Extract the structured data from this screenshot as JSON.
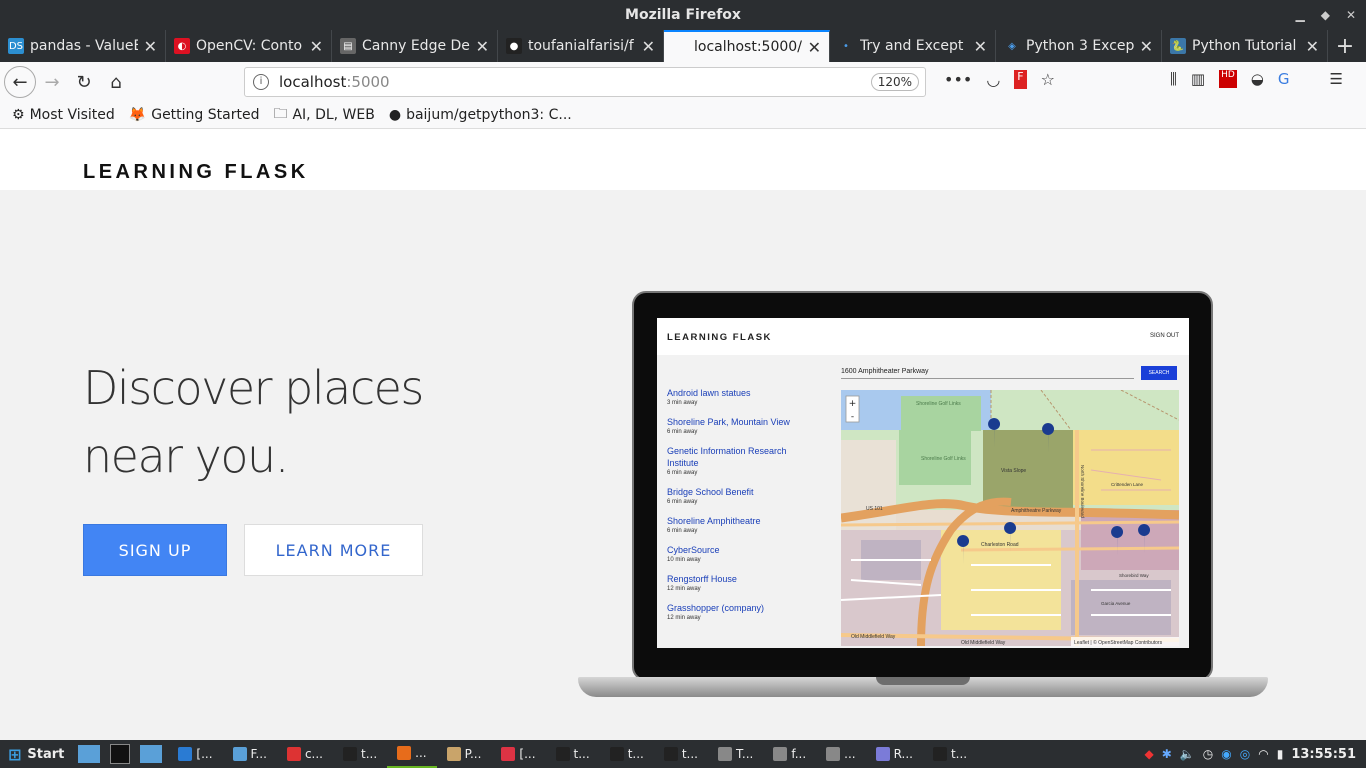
{
  "window": {
    "title": "Mozilla Firefox"
  },
  "tabs": [
    {
      "label": "pandas - ValueE",
      "icon": "pandas-favicon",
      "color": "#2c8fd1",
      "glyph": "DS",
      "active": false
    },
    {
      "label": "OpenCV: Conto",
      "icon": "opencv-favicon",
      "color": "#d12",
      "glyph": "◐",
      "active": false
    },
    {
      "label": "Canny Edge De",
      "icon": "document-favicon",
      "color": "#666",
      "glyph": "▤",
      "active": false
    },
    {
      "label": "toufanialfarisi/f",
      "icon": "github-favicon",
      "color": "#222",
      "glyph": "●",
      "active": false
    },
    {
      "label": "localhost:5000/",
      "icon": "none",
      "color": "transparent",
      "glyph": "",
      "active": true
    },
    {
      "label": "Try and Except",
      "icon": "dot-favicon",
      "color": "transparent",
      "glyph": "•",
      "active": false
    },
    {
      "label": "Python 3 Excep",
      "icon": "diamond-favicon",
      "color": "transparent",
      "glyph": "◈",
      "active": false
    },
    {
      "label": "Python Tutorial",
      "icon": "python-favicon",
      "color": "#3b77a8",
      "glyph": "🐍",
      "active": false
    }
  ],
  "nav": {
    "url_host": "localhost",
    "url_port": ":5000",
    "zoom": "120%"
  },
  "bookmarks": [
    {
      "label": "Most Visited",
      "icon": "gear-icon",
      "glyph": "⚙"
    },
    {
      "label": "Getting Started",
      "icon": "firefox-icon",
      "glyph": "🦊"
    },
    {
      "label": "AI, DL, WEB",
      "icon": "folder-icon",
      "glyph": "🗀"
    },
    {
      "label": "baijum/getpython3: C...",
      "icon": "github-icon",
      "glyph": "●"
    }
  ],
  "site": {
    "brand": "LEARNING FLASK",
    "hero_line1": "Discover places",
    "hero_line2": "near you.",
    "signup_label": "SIGN UP",
    "learn_label": "LEARN MORE",
    "accent": "#4285f4"
  },
  "mock": {
    "brand": "LEARNING FLASK",
    "signout": "SIGN OUT",
    "search_value": "1600 Amphitheater Parkway",
    "search_button": "SEARCH",
    "places": [
      {
        "name": "Android lawn statues",
        "dist": "3 min away"
      },
      {
        "name": "Shoreline Park, Mountain View",
        "dist": "6 min away"
      },
      {
        "name": "Genetic Information Research Institute",
        "dist": "6 min away"
      },
      {
        "name": "Bridge School Benefit",
        "dist": "6 min away"
      },
      {
        "name": "Shoreline Amphitheatre",
        "dist": "6 min away"
      },
      {
        "name": "CyberSource",
        "dist": "10 min away"
      },
      {
        "name": "Rengstorff House",
        "dist": "12 min away"
      },
      {
        "name": "Grasshopper (company)",
        "dist": "12 min away"
      }
    ],
    "map": {
      "zoom_in": "+",
      "zoom_out": "-",
      "attribution": "Leaflet | © OpenStreetMap Contributors",
      "labels": [
        "Shoreline Golf Links",
        "Shoreline Golf Links",
        "Vista Slope",
        "Amphitheatre Parkway",
        "Charleston Road",
        "US 101",
        "Old Middlefield Way",
        "Old Middlefield Way",
        "Crittenden Lane",
        "North Shoreline Boulevard",
        "Shorebird Way",
        "Garcia Avenue"
      ]
    }
  },
  "taskbar": {
    "start_label": "Start",
    "items": [
      {
        "label": "[...",
        "icon": "vscode-icon",
        "color": "#2a7bd3"
      },
      {
        "label": "F...",
        "icon": "files-icon",
        "color": "#5aa0d8"
      },
      {
        "label": "c...",
        "icon": "app-icon",
        "color": "#d33"
      },
      {
        "label": "t...",
        "icon": "terminal-icon",
        "color": "#222"
      },
      {
        "label": "...",
        "icon": "firefox-icon",
        "color": "#e76c1b"
      },
      {
        "label": "P...",
        "icon": "package-icon",
        "color": "#c9a46a"
      },
      {
        "label": "[...",
        "icon": "app2-icon",
        "color": "#d34"
      },
      {
        "label": "t...",
        "icon": "terminal-icon",
        "color": "#222"
      },
      {
        "label": "t...",
        "icon": "terminal-icon",
        "color": "#222"
      },
      {
        "label": "t...",
        "icon": "terminal-icon",
        "color": "#222"
      },
      {
        "label": "T...",
        "icon": "window-icon",
        "color": "#888"
      },
      {
        "label": "f...",
        "icon": "window-icon",
        "color": "#888"
      },
      {
        "label": "...",
        "icon": "window-icon",
        "color": "#888"
      },
      {
        "label": "R...",
        "icon": "reader-icon",
        "color": "#7b7bd8"
      },
      {
        "label": "t...",
        "icon": "terminal-icon",
        "color": "#222"
      }
    ],
    "clock": "13:55:51"
  }
}
